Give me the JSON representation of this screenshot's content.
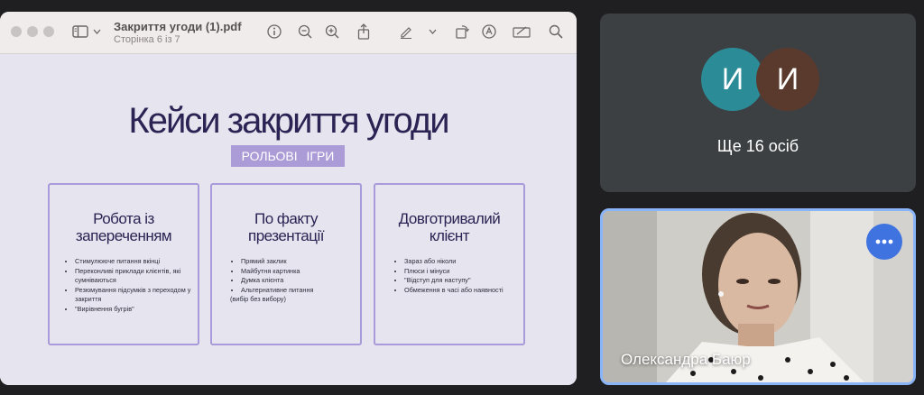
{
  "pdf_viewer": {
    "doc_title": "Закриття угоди (1).pdf",
    "page_indicator": "Сторінка 6 із 7",
    "icons": [
      "sidebar-icon",
      "chevron-down-icon",
      "info-icon",
      "zoom-out-icon",
      "zoom-in-icon",
      "share-icon",
      "markup-icon",
      "chevron-down-icon",
      "rotate-icon",
      "annotate-icon",
      "redact-icon",
      "search-icon"
    ]
  },
  "slide": {
    "title": "Кейси закриття угоди",
    "badge": "РОЛЬОВІ ІГРИ",
    "cards": [
      {
        "heading": "Робота із запереченням",
        "items": [
          "Стимулююче питання вкінці",
          "Переконливі приклади клієнтів, які сумніваються",
          "Резюмування підсумків з переходом у закриття",
          "\"Вирівнення бугрів\""
        ],
        "tail": ""
      },
      {
        "heading": "По факту презентації",
        "items": [
          "Прямий заклик",
          "Майбутня картинка",
          "Думка клієнта",
          "Альтернативне питання"
        ],
        "tail": "(вибір без вибору)"
      },
      {
        "heading": "Довготривалий клієнт",
        "items": [
          "Зараз або ніколи",
          "Плюси і мінуси",
          "\"Відступ для наступу\"",
          "Обмеження в часі або наявності"
        ],
        "tail": ""
      }
    ]
  },
  "meet": {
    "others_tile": {
      "avatars": [
        "И",
        "И"
      ],
      "avatar_colors": [
        "#2b8b97",
        "#5b3a2e"
      ],
      "label": "Ще 16 осіб"
    },
    "speaker_tile": {
      "name": "Олександра Баюр",
      "highlight_color": "#8ab4f8"
    }
  }
}
